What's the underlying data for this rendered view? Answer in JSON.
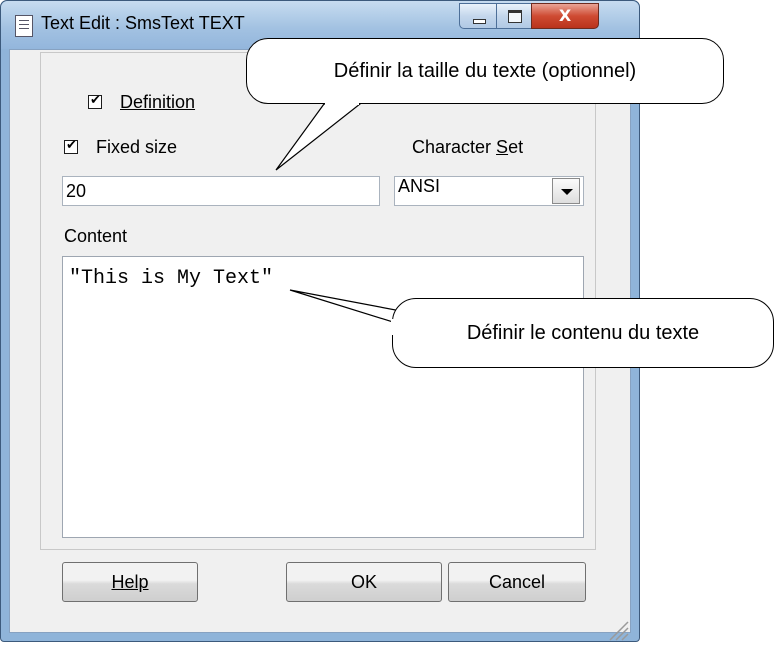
{
  "window": {
    "title": "Text Edit : SmsText TEXT",
    "close_glyph": "X"
  },
  "group": {
    "label": "Definition",
    "checked": true
  },
  "fixed_size": {
    "label": "Fixed size",
    "checked": true,
    "value": "20"
  },
  "charset": {
    "label": "Character Set",
    "selected": "ANSI"
  },
  "content": {
    "label": "Content",
    "value": "\"This is My Text\""
  },
  "buttons": {
    "help": "Help",
    "ok": "OK",
    "cancel": "Cancel"
  },
  "callouts": {
    "size": "Définir la taille du texte (optionnel)",
    "content": "Définir le contenu du texte"
  },
  "colors": {
    "window_frame": "#8fb4d9",
    "close_button": "#cf4b33",
    "client_bg": "#f0f0f0"
  },
  "icons": [
    "document-icon",
    "minimize-icon",
    "maximize-icon",
    "close-icon",
    "dropdown-arrow-icon",
    "resize-grip-icon"
  ]
}
